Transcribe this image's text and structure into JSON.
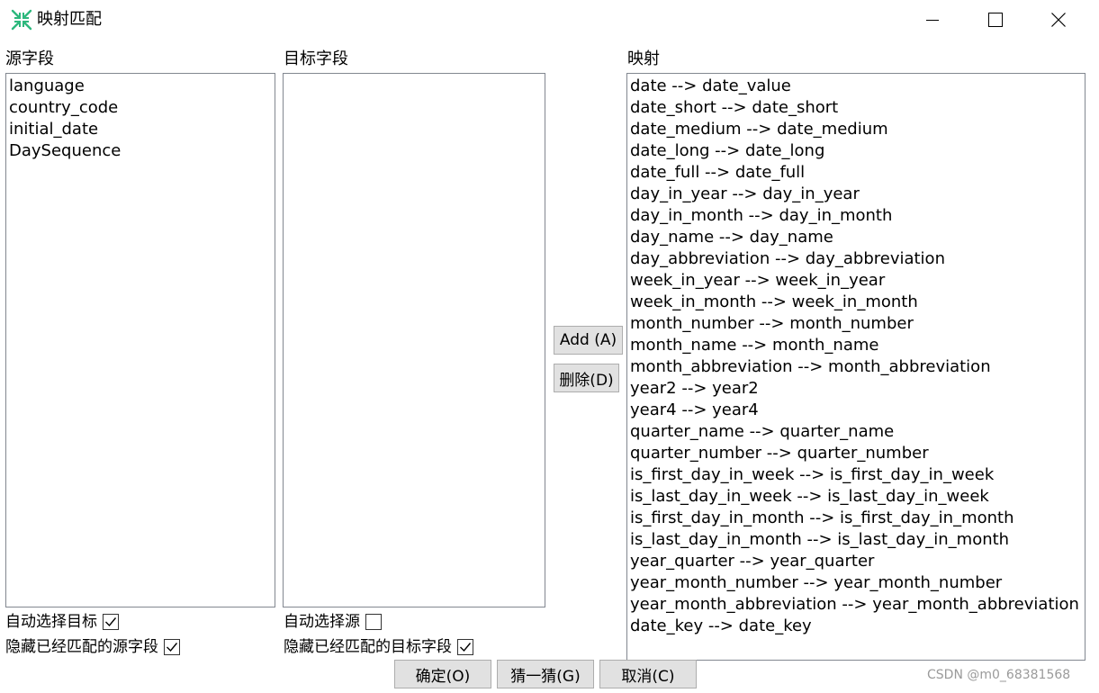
{
  "window": {
    "title": "映射匹配",
    "accent_color": "#2db87d"
  },
  "source": {
    "label": "源字段",
    "items": [
      "language",
      "country_code",
      "initial_date",
      "DaySequence"
    ]
  },
  "target": {
    "label": "目标字段",
    "items": []
  },
  "mapping": {
    "label": "映射",
    "items": [
      "date --> date_value",
      "date_short --> date_short",
      "date_medium --> date_medium",
      "date_long --> date_long",
      "date_full --> date_full",
      "day_in_year --> day_in_year",
      "day_in_month --> day_in_month",
      "day_name --> day_name",
      "day_abbreviation --> day_abbreviation",
      "week_in_year --> week_in_year",
      "week_in_month --> week_in_month",
      "month_number --> month_number",
      "month_name --> month_name",
      "month_abbreviation --> month_abbreviation",
      "year2 --> year2",
      "year4 --> year4",
      "quarter_name --> quarter_name",
      "quarter_number --> quarter_number",
      "is_first_day_in_week --> is_first_day_in_week",
      "is_last_day_in_week --> is_last_day_in_week",
      "is_first_day_in_month --> is_first_day_in_month",
      "is_last_day_in_month --> is_last_day_in_month",
      "year_quarter --> year_quarter",
      "year_month_number --> year_month_number",
      "year_month_abbreviation --> year_month_abbreviation",
      "date_key --> date_key"
    ]
  },
  "buttons": {
    "add": "Add (A)",
    "delete": "删除(D)",
    "ok": "确定(O)",
    "guess": "猜一猜(G)",
    "cancel": "取消(C)"
  },
  "options": {
    "auto_select_target": {
      "label": "自动选择目标",
      "checked": true
    },
    "hide_matched_source": {
      "label": "隐藏已经匹配的源字段",
      "checked": true
    },
    "auto_select_source": {
      "label": "自动选择源",
      "checked": false
    },
    "hide_matched_target": {
      "label": "隐藏已经匹配的目标字段",
      "checked": true
    }
  },
  "watermark": "CSDN @m0_68381568"
}
